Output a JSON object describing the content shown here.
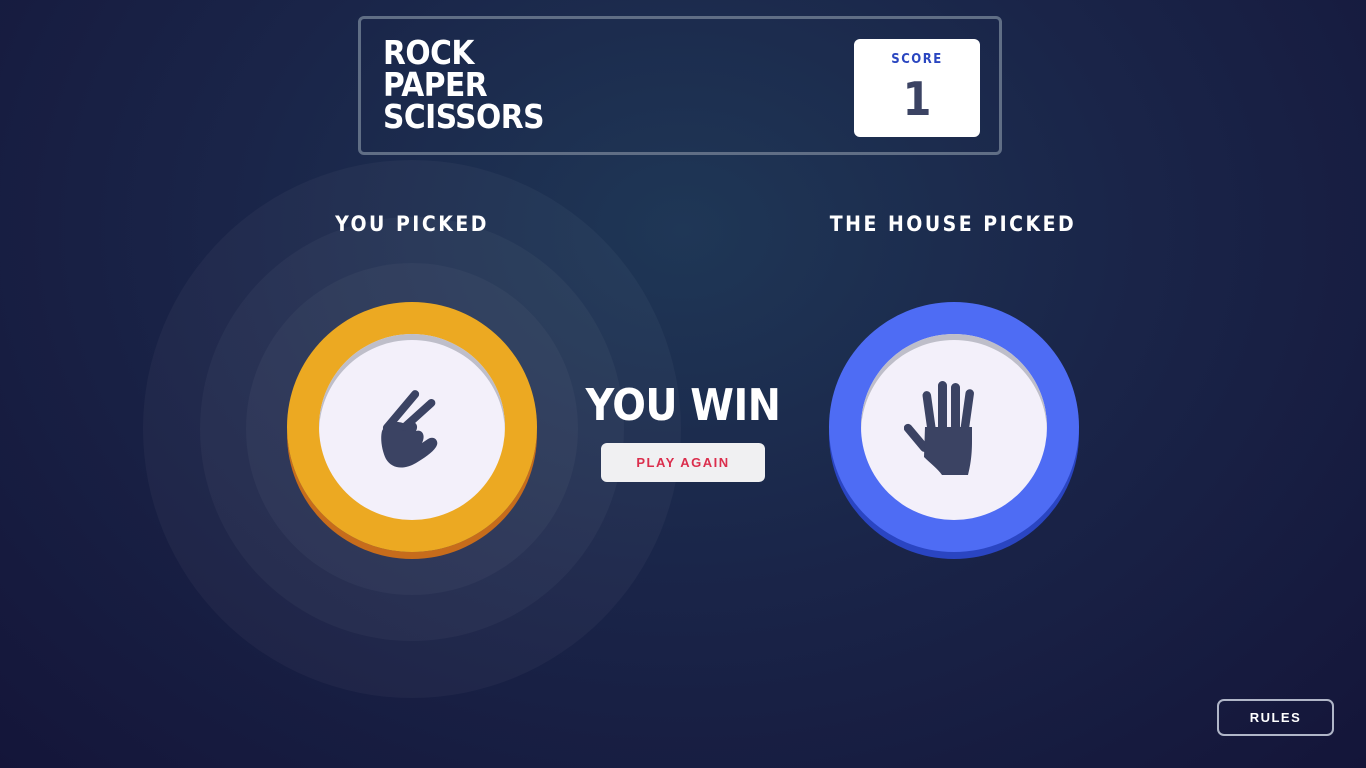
{
  "header": {
    "title_lines": [
      "ROCK",
      "PAPER",
      "SCISSORS"
    ],
    "score_label": "SCORE",
    "score_value": "1"
  },
  "game": {
    "player_title": "YOU PICKED",
    "house_title": "THE HOUSE PICKED",
    "player_pick": "scissors",
    "house_pick": "paper",
    "result_text": "YOU WIN",
    "play_again_label": "PLAY AGAIN"
  },
  "footer": {
    "rules_label": "RULES"
  },
  "colors": {
    "background": "#1f3756",
    "scissors": "#eca922",
    "paper": "#4e6cf4",
    "play_again_text": "#db2e4d",
    "score_label": "#2a46c0",
    "score_value": "#3b4363"
  },
  "icons": {
    "player_token": "scissors-icon",
    "house_token": "paper-icon"
  }
}
